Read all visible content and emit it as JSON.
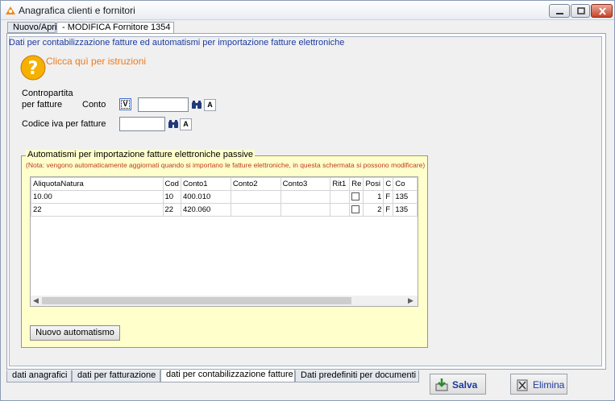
{
  "window": {
    "title": "Anagrafica clienti e fornitori"
  },
  "top_tabs": [
    {
      "label": "Nuovo/Apri"
    },
    {
      "label": "- MODIFICA Fornitore 1354"
    }
  ],
  "header": {
    "text": "Dati per contabilizzazione fatture ed automatismi per importazione fatture elettroniche"
  },
  "help": {
    "link": "Clicca quì per istruzioni"
  },
  "contropartita": {
    "label_line1": "Contropartita",
    "label_line2": "per fatture",
    "conto_label": "Conto",
    "v_button": "V",
    "conto_value": "",
    "a_button": "A"
  },
  "codice_iva": {
    "label": "Codice iva per fatture",
    "value": "",
    "a_button": "A"
  },
  "automatismi": {
    "title": "Automatismi per importazione fatture elettroniche passive",
    "note": "(Nota: vengono automaticamente aggiornati quando si importano le fatture elettroniche, in questa schermata si possono modificare)",
    "columns": [
      "AliquotaNatura",
      "Cod",
      "Conto1",
      "Conto2",
      "Conto3",
      "Rit1",
      "Re",
      "Posi",
      "C",
      "Co"
    ],
    "rows": [
      {
        "aliquota": "10.00",
        "cod": "10",
        "conto1": "400.010",
        "conto2": "",
        "conto3": "",
        "rit1": "",
        "posi": "1",
        "c": "F",
        "co": "135"
      },
      {
        "aliquota": "22",
        "cod": "22",
        "conto1": "420.060",
        "conto2": "",
        "conto3": "",
        "rit1": "",
        "posi": "2",
        "c": "F",
        "co": "135"
      }
    ],
    "new_button": "Nuovo automatismo"
  },
  "bottom_tabs": [
    {
      "label": "dati anagrafici"
    },
    {
      "label": "dati per fatturazione"
    },
    {
      "label": "dati per contabilizzazione fatture"
    },
    {
      "label": "Dati predefiniti per documenti"
    }
  ],
  "actions": {
    "save": "Salva",
    "delete": "Elimina"
  },
  "colors": {
    "header_text": "#1c3aa0",
    "help_link": "#f07a1a",
    "note_text": "#c03a1a",
    "group_bg": "#ffffcc"
  }
}
